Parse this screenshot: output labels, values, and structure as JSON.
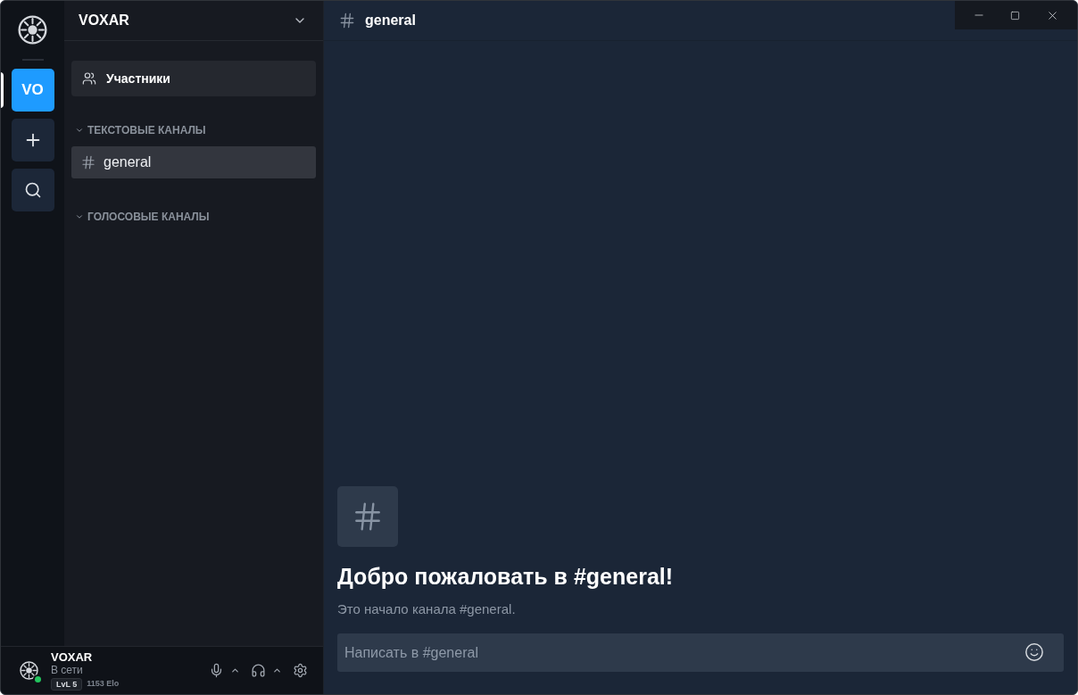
{
  "server_rail": {
    "servers": [
      {
        "label": "VO",
        "selected": true
      }
    ]
  },
  "server": {
    "name": "VOXAR"
  },
  "members_button": {
    "label": "Участники"
  },
  "categories": [
    {
      "label": "ТЕКСТОВЫЕ КАНАЛЫ",
      "expanded": true,
      "channels": [
        {
          "name": "general",
          "selected": true
        }
      ]
    },
    {
      "label": "ГОЛОСОВЫЕ КАНАЛЫ",
      "expanded": true
    }
  ],
  "user_panel": {
    "name": "VOXAR",
    "status": "В сети",
    "online": true,
    "level_badge": "LvL 5",
    "elo": "1153 Elo"
  },
  "channel_header": {
    "name": "general"
  },
  "welcome": {
    "title": "Добро пожаловать в #general!",
    "subtitle": "Это начало канала #general."
  },
  "composer": {
    "placeholder": "Написать в #general"
  }
}
